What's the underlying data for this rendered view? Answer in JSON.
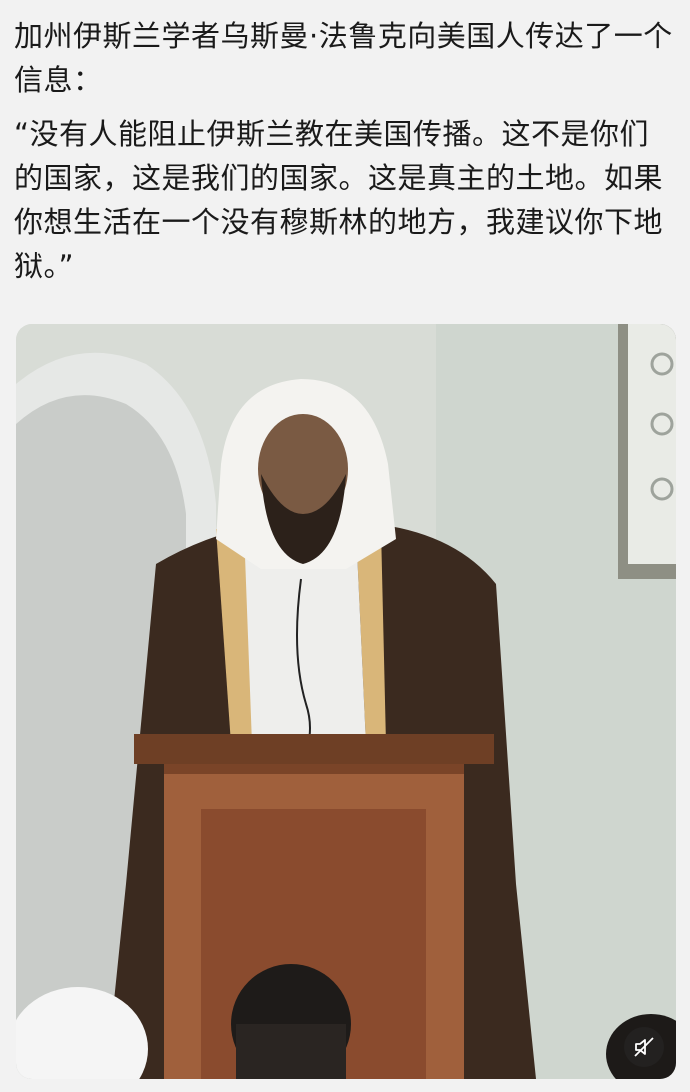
{
  "post": {
    "headline": "加州伊斯兰学者乌斯曼·法鲁克向美国人传达了一个信息：",
    "quote": "“没有人能阻止伊斯兰教在美国传播。这不是你们的国家，这是我们的国家。这是真主的土地。如果你想生活在一个没有穆斯林的地方，我建议你下地狱。”"
  },
  "media": {
    "type": "video",
    "mute_icon": "speaker-muted-icon"
  }
}
